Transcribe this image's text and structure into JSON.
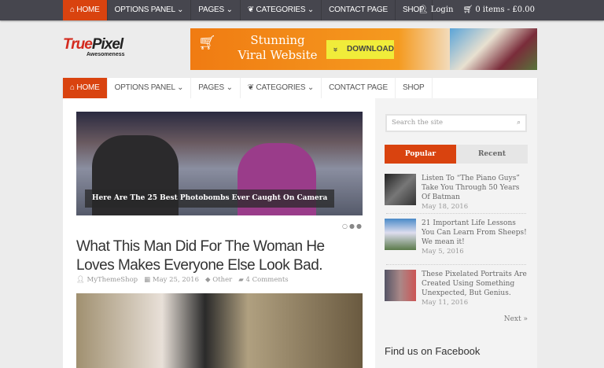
{
  "nav": {
    "items": [
      "HOME",
      "OPTIONS PANEL",
      "PAGES",
      "CATEGORIES",
      "CONTACT PAGE",
      "SHOP"
    ]
  },
  "top": {
    "login": "Login",
    "cart": "0 items - £0.00"
  },
  "logo": {
    "true": "True",
    "pixel": "Pixel",
    "tagline": "Awesomeness"
  },
  "banner": {
    "line1": "Stunning",
    "line2": "Viral Website",
    "button": "DOWNLOAD"
  },
  "slider": {
    "caption": "Here Are The 25 Best Photobombs Ever Caught On Camera"
  },
  "article": {
    "title": "What This Man Did For The Woman He Loves Makes Everyone Else Look Bad.",
    "author": "MyThemeShop",
    "date": "May 25, 2016",
    "category": "Other",
    "comments": "4 Comments"
  },
  "sidebar": {
    "search_placeholder": "Search the site",
    "tab_popular": "Popular",
    "tab_recent": "Recent",
    "posts": [
      {
        "title": "Listen To “The Piano Guys” Take You Through 50 Years Of Batman",
        "date": "May 18, 2016"
      },
      {
        "title": "21 Important Life Lessons You Can Learn From Sheeps! We mean it!",
        "date": "May 5, 2016"
      },
      {
        "title": "These Pixelated Portraits Are Created Using Something Unexpected, But Genius.",
        "date": "May 11, 2016"
      }
    ],
    "next": "Next »",
    "facebook_heading": "Find us on Facebook"
  }
}
